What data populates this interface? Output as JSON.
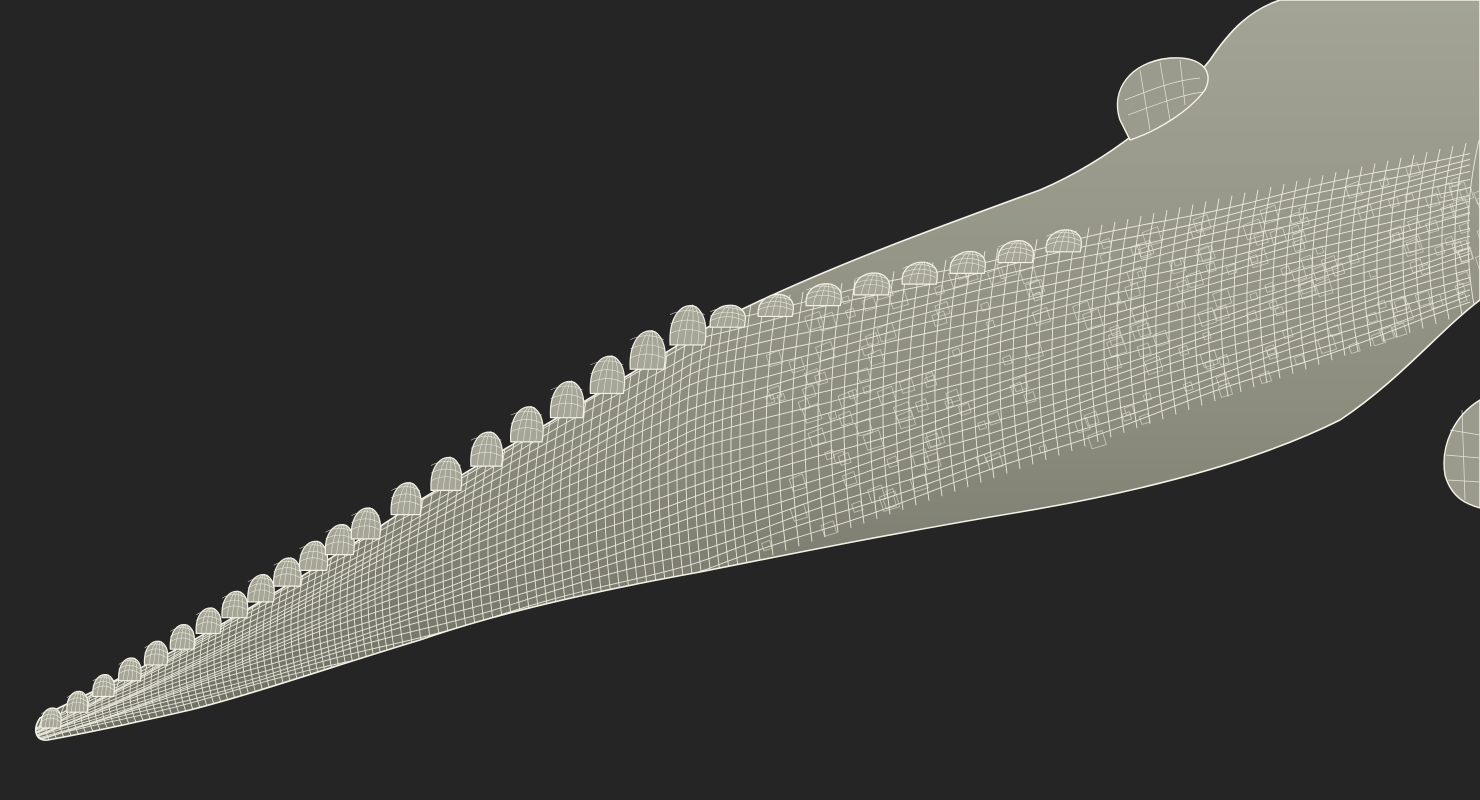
{
  "scene": {
    "subject": "crocodile-tail-wireframe",
    "background_color": "#252525",
    "mesh_fill_color": "#8c8d7f",
    "mesh_shade_color": "#727366",
    "mesh_highlight_color": "#a3a496",
    "wire_color": "#f4f2e6"
  }
}
